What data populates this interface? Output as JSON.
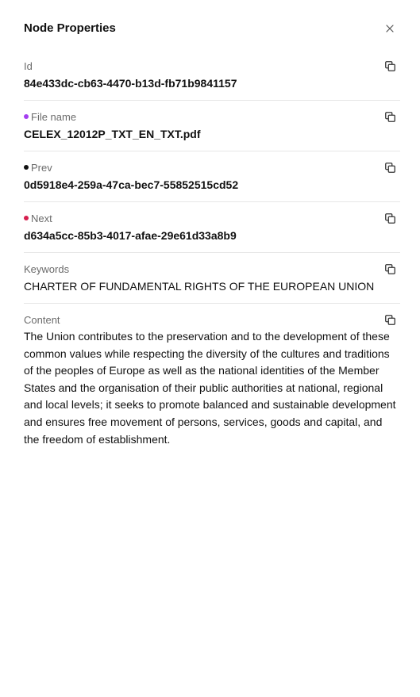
{
  "panel": {
    "title": "Node Properties",
    "close_icon": "close-icon"
  },
  "properties": [
    {
      "key": "id",
      "label": "Id",
      "value": "84e433dc-cb63-4470-b13d-fb71b9841157",
      "dot_color": null,
      "bold": true
    },
    {
      "key": "file_name",
      "label": "File name",
      "value": "CELEX_12012P_TXT_EN_TXT.pdf",
      "dot_color": "#a43ef0",
      "bold": true
    },
    {
      "key": "prev",
      "label": "Prev",
      "value": "0d5918e4-259a-47ca-bec7-55852515cd52",
      "dot_color": "#111111",
      "bold": true
    },
    {
      "key": "next",
      "label": "Next",
      "value": "d634a5cc-85b3-4017-afae-29e61d33a8b9",
      "dot_color": "#d61f4e",
      "bold": true
    },
    {
      "key": "keywords",
      "label": "Keywords",
      "value": "CHARTER OF FUNDAMENTAL RIGHTS OF THE EUROPEAN UNION",
      "dot_color": null,
      "bold": false
    },
    {
      "key": "content",
      "label": "Content",
      "value": "The Union contributes to the preservation and to the development of these common values while respecting the diversity of the cultures and traditions of the peoples of Europe as well as the national identities of the Member States and the organisation of their public authorities at national, regional and local levels; it seeks to promote balanced and sustainable development and ensures free movement of persons, services, goods and capital, and the freedom of establishment.",
      "dot_color": null,
      "bold": false
    }
  ],
  "icons": {
    "copy": "copy-icon"
  }
}
